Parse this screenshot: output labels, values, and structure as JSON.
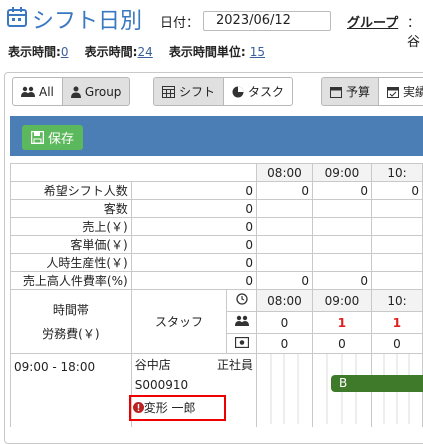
{
  "header": {
    "title": "シフト日別",
    "date_label": "日付：",
    "date_value": "2023/06/12",
    "group_label": "グループ",
    "group_value": "：谷"
  },
  "info": {
    "start_label": "表示時間:",
    "start_value": "0",
    "end_label": "表示時間:",
    "end_value": "24",
    "unit_label": "表示時間単位:",
    "unit_value": "15"
  },
  "toolbar": {
    "view_group": [
      {
        "label": "All",
        "icon": "users-icon",
        "active": false
      },
      {
        "label": "Group",
        "icon": "user-icon",
        "active": true
      }
    ],
    "mode_group": [
      {
        "label": "シフト",
        "icon": "calendar-grid-icon",
        "active": true
      },
      {
        "label": "タスク",
        "icon": "pie-icon",
        "active": false
      }
    ],
    "extra_group": [
      {
        "label": "予算",
        "icon": "calendar-icon",
        "active": true
      },
      {
        "label": "実績",
        "icon": "calendar-check-icon",
        "active": false
      }
    ],
    "save_label": "保存"
  },
  "summary": {
    "times": [
      "08:00",
      "09:00",
      "10:"
    ],
    "rows": [
      {
        "label": "希望シフト人数",
        "total": "0",
        "cells": [
          "0",
          "0",
          "0"
        ]
      },
      {
        "label": "客数",
        "total": "0",
        "cells": [
          "",
          "",
          ""
        ]
      },
      {
        "label": "売上(￥)",
        "total": "0",
        "cells": [
          "",
          "",
          ""
        ]
      },
      {
        "label": "客単価(￥)",
        "total": "0",
        "cells": [
          "",
          "",
          ""
        ]
      },
      {
        "label": "人時生産性(￥)",
        "total": "0",
        "cells": [
          "",
          "",
          ""
        ]
      },
      {
        "label": "売上高人件費率(%)",
        "total": "0",
        "cells": [
          "0",
          "0",
          ""
        ]
      }
    ]
  },
  "staff_header": {
    "timeslot_label": "時間帯",
    "labor_label": "労務費(￥)",
    "staff_label": "スタッフ",
    "times": [
      "08:00",
      "09:00",
      "10:"
    ],
    "staff_counts": [
      "0",
      "1",
      "1"
    ],
    "cost_values": [
      "0",
      "0",
      "0"
    ]
  },
  "employee": {
    "time_range": "09:00 - 18:00",
    "store": "谷中店",
    "employment": "正社員",
    "code": "S000910",
    "name": "変形 一郎",
    "bar_label": "B"
  },
  "colors": {
    "title_blue": "#3a78c2",
    "bar_blue": "#4a7eb5",
    "save_green": "#5cb85c",
    "shift_green": "#3f7a2b",
    "alert_red": "#dd2222"
  }
}
